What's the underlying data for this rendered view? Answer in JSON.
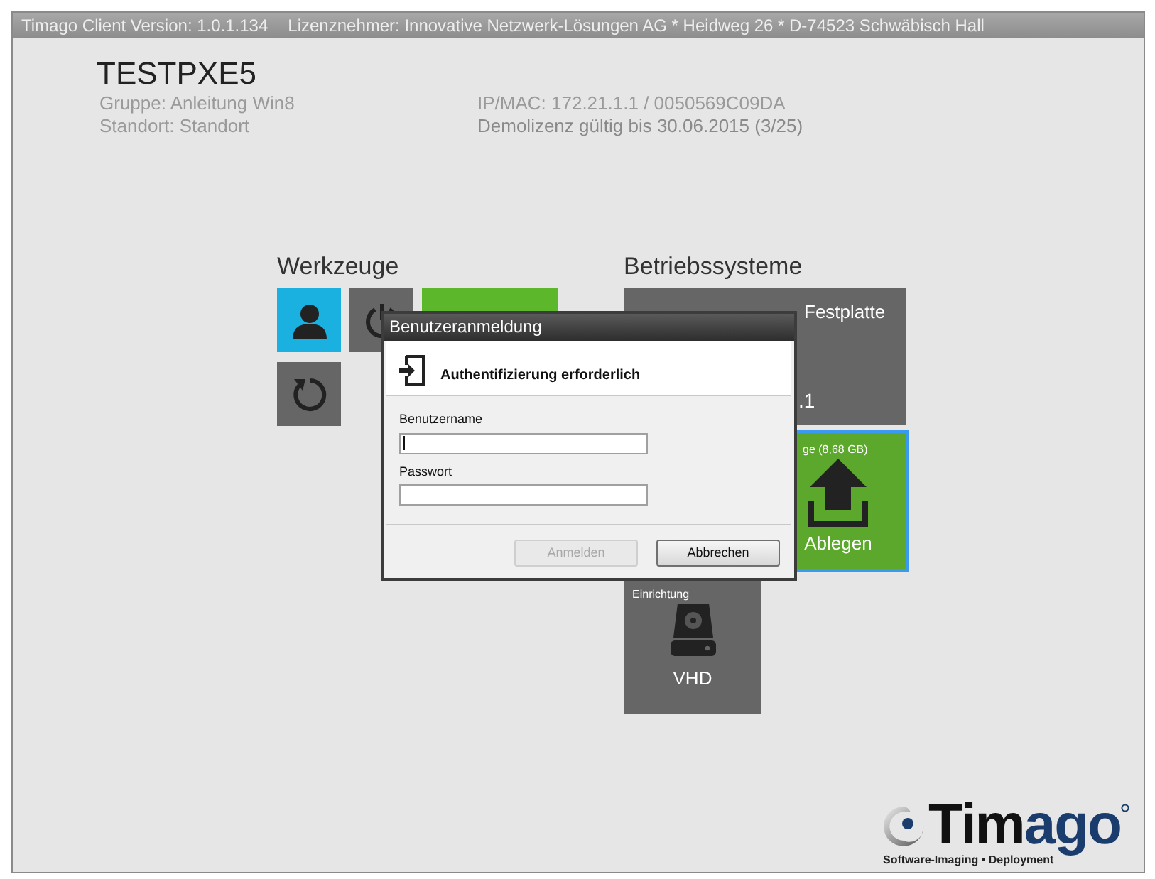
{
  "title_bar": {
    "version": "Timago Client Version: 1.0.1.134",
    "licensee": "Lizenznehmer: Innovative Netzwerk-Lösungen AG * Heidweg 26 * D-74523 Schwäbisch Hall"
  },
  "header": {
    "name": "TESTPXE5",
    "group": "Gruppe: Anleitung Win8",
    "location": "Standort: Standort",
    "ip_mac": "IP/MAC: 172.21.1.1 / 0050569C09DA",
    "license": "Demolizenz gültig bis 30.06.2015 (3/25)"
  },
  "tools": {
    "heading": "Werkzeuge",
    "tiles": [
      {
        "kind": "user",
        "color": "#1ab0e0",
        "selected": false
      },
      {
        "kind": "power",
        "color": "#666666",
        "selected": false
      },
      {
        "kind": "status",
        "color": "#5cb82a",
        "selected": false
      },
      {
        "kind": "refresh",
        "color": "#666666",
        "selected": false
      }
    ]
  },
  "systems": {
    "heading": "Betriebssysteme",
    "tiles": [
      {
        "kind": "os",
        "color": "#666666",
        "selected": false,
        "title": "Festplatte",
        "label": ".1"
      },
      {
        "kind": "upload",
        "color": "#5ca82c",
        "selected": true,
        "title": "ge (8,68 GB)",
        "label": "Ablegen"
      },
      {
        "kind": "vhd",
        "color": "#666666",
        "selected": false,
        "title": "Einrichtung",
        "label": "VHD"
      }
    ]
  },
  "dialog": {
    "title": "Benutzeranmeldung",
    "heading": "Authentifizierung erforderlich",
    "fields": [
      {
        "label": "Benutzername",
        "focused": true
      },
      {
        "label": "Passwort",
        "focused": false
      }
    ],
    "buttons": [
      {
        "label": "Anmelden",
        "disabled": true
      },
      {
        "label": "Abbrechen",
        "disabled": false
      }
    ]
  },
  "logo": {
    "text_dark": "Tim",
    "text_blue": "ago",
    "tagline": "Software-Imaging • Deployment"
  }
}
